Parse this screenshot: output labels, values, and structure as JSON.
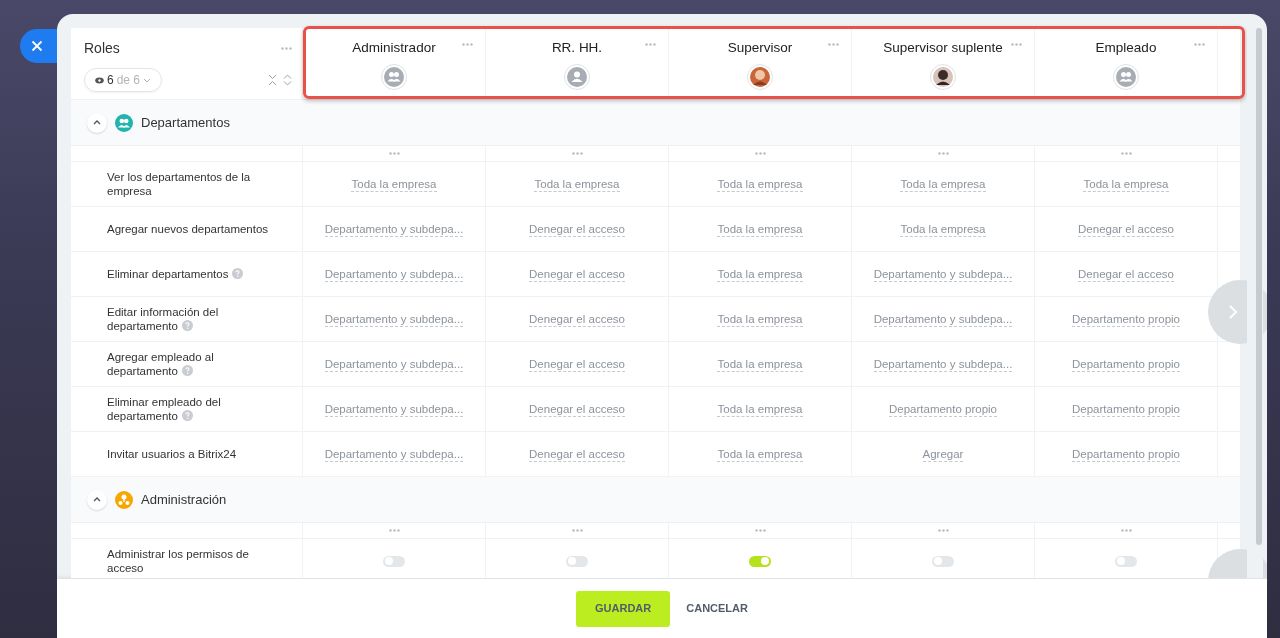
{
  "roles_panel": {
    "title": "Roles",
    "filter_count": "6",
    "filter_total": "de 6"
  },
  "roles": [
    {
      "name": "Administrador",
      "kind": "group"
    },
    {
      "name": "RR. HH.",
      "kind": "user"
    },
    {
      "name": "Supervisor",
      "kind": "photo"
    },
    {
      "name": "Supervisor suplente",
      "kind": "photo"
    },
    {
      "name": "Empleado",
      "kind": "group"
    }
  ],
  "sections": [
    {
      "title": "Departamentos",
      "color": "#1fb5ad",
      "expanded": true,
      "rows": [
        {
          "label": "Ver los departamentos de la empresa",
          "help": false,
          "kind": "select",
          "values": [
            "Toda la empresa",
            "Toda la empresa",
            "Toda la empresa",
            "Toda la empresa",
            "Toda la empresa"
          ]
        },
        {
          "label": "Agregar nuevos departamentos",
          "help": false,
          "kind": "select",
          "values": [
            "Departamento y subdepa...",
            "Denegar el acceso",
            "Toda la empresa",
            "Toda la empresa",
            "Denegar el acceso"
          ]
        },
        {
          "label": "Eliminar departamentos",
          "help": true,
          "kind": "select",
          "values": [
            "Departamento y subdepa...",
            "Denegar el acceso",
            "Toda la empresa",
            "Departamento y subdepa...",
            "Denegar el acceso"
          ]
        },
        {
          "label": "Editar información del departamento",
          "help": true,
          "kind": "select",
          "values": [
            "Departamento y subdepa...",
            "Denegar el acceso",
            "Toda la empresa",
            "Departamento y subdepa...",
            "Departamento propio"
          ]
        },
        {
          "label": "Agregar empleado al departamento",
          "help": true,
          "kind": "select",
          "values": [
            "Departamento y subdepa...",
            "Denegar el acceso",
            "Toda la empresa",
            "Departamento y subdepa...",
            "Departamento propio"
          ]
        },
        {
          "label": "Eliminar empleado del departamento",
          "help": true,
          "kind": "select",
          "values": [
            "Departamento y subdepa...",
            "Denegar el acceso",
            "Toda la empresa",
            "Departamento propio",
            "Departamento propio"
          ]
        },
        {
          "label": "Invitar usuarios a Bitrix24",
          "help": false,
          "kind": "select",
          "values": [
            "Departamento y subdepa...",
            "Denegar el acceso",
            "Toda la empresa",
            "Agregar",
            "Departamento propio"
          ]
        }
      ]
    },
    {
      "title": "Administración",
      "color": "#f7a700",
      "expanded": true,
      "rows": [
        {
          "label": "Administrar los permisos de acceso",
          "help": false,
          "kind": "toggle",
          "toggles": [
            {
              "on": false
            },
            {
              "on": false
            },
            {
              "on": true
            },
            {
              "on": false
            },
            {
              "on": false
            }
          ]
        }
      ]
    }
  ],
  "footer": {
    "buttons": [
      {
        "label": "GUARDAR",
        "kind": "primary"
      },
      {
        "label": "CANCELAR",
        "kind": "link"
      }
    ]
  }
}
